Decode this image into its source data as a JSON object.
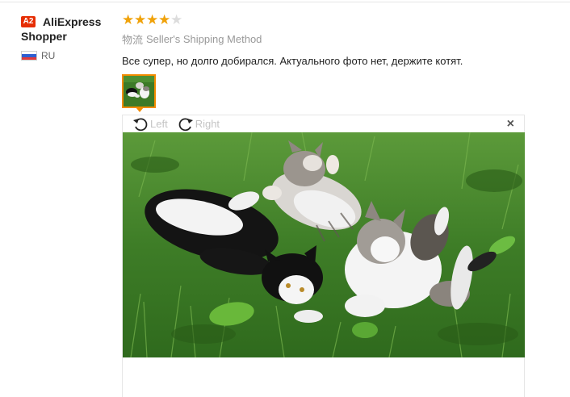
{
  "buyer": {
    "badge": "A2",
    "name_line1": "AliExpress",
    "name_line2": "Shopper",
    "country": "RU",
    "flag_colors": [
      "#ffffff",
      "#2f5fd0",
      "#e03a3a"
    ]
  },
  "review": {
    "rating": 4,
    "max_rating": 5,
    "shipping_label_cn": "物流",
    "shipping_method": "Seller's Shipping Method",
    "text": "Все супер, но долго добирался. Актуального фото нет, держите котят."
  },
  "viewer": {
    "rotate_left_label": "Left",
    "rotate_right_label": "Right",
    "close_glyph": "×",
    "photo_subject": "kittens-on-grass"
  },
  "colors": {
    "star_full": "#f0a20a",
    "star_empty": "#dcdcdc",
    "badge_bg": "#e62e04",
    "thumb_border": "#f28b00"
  }
}
